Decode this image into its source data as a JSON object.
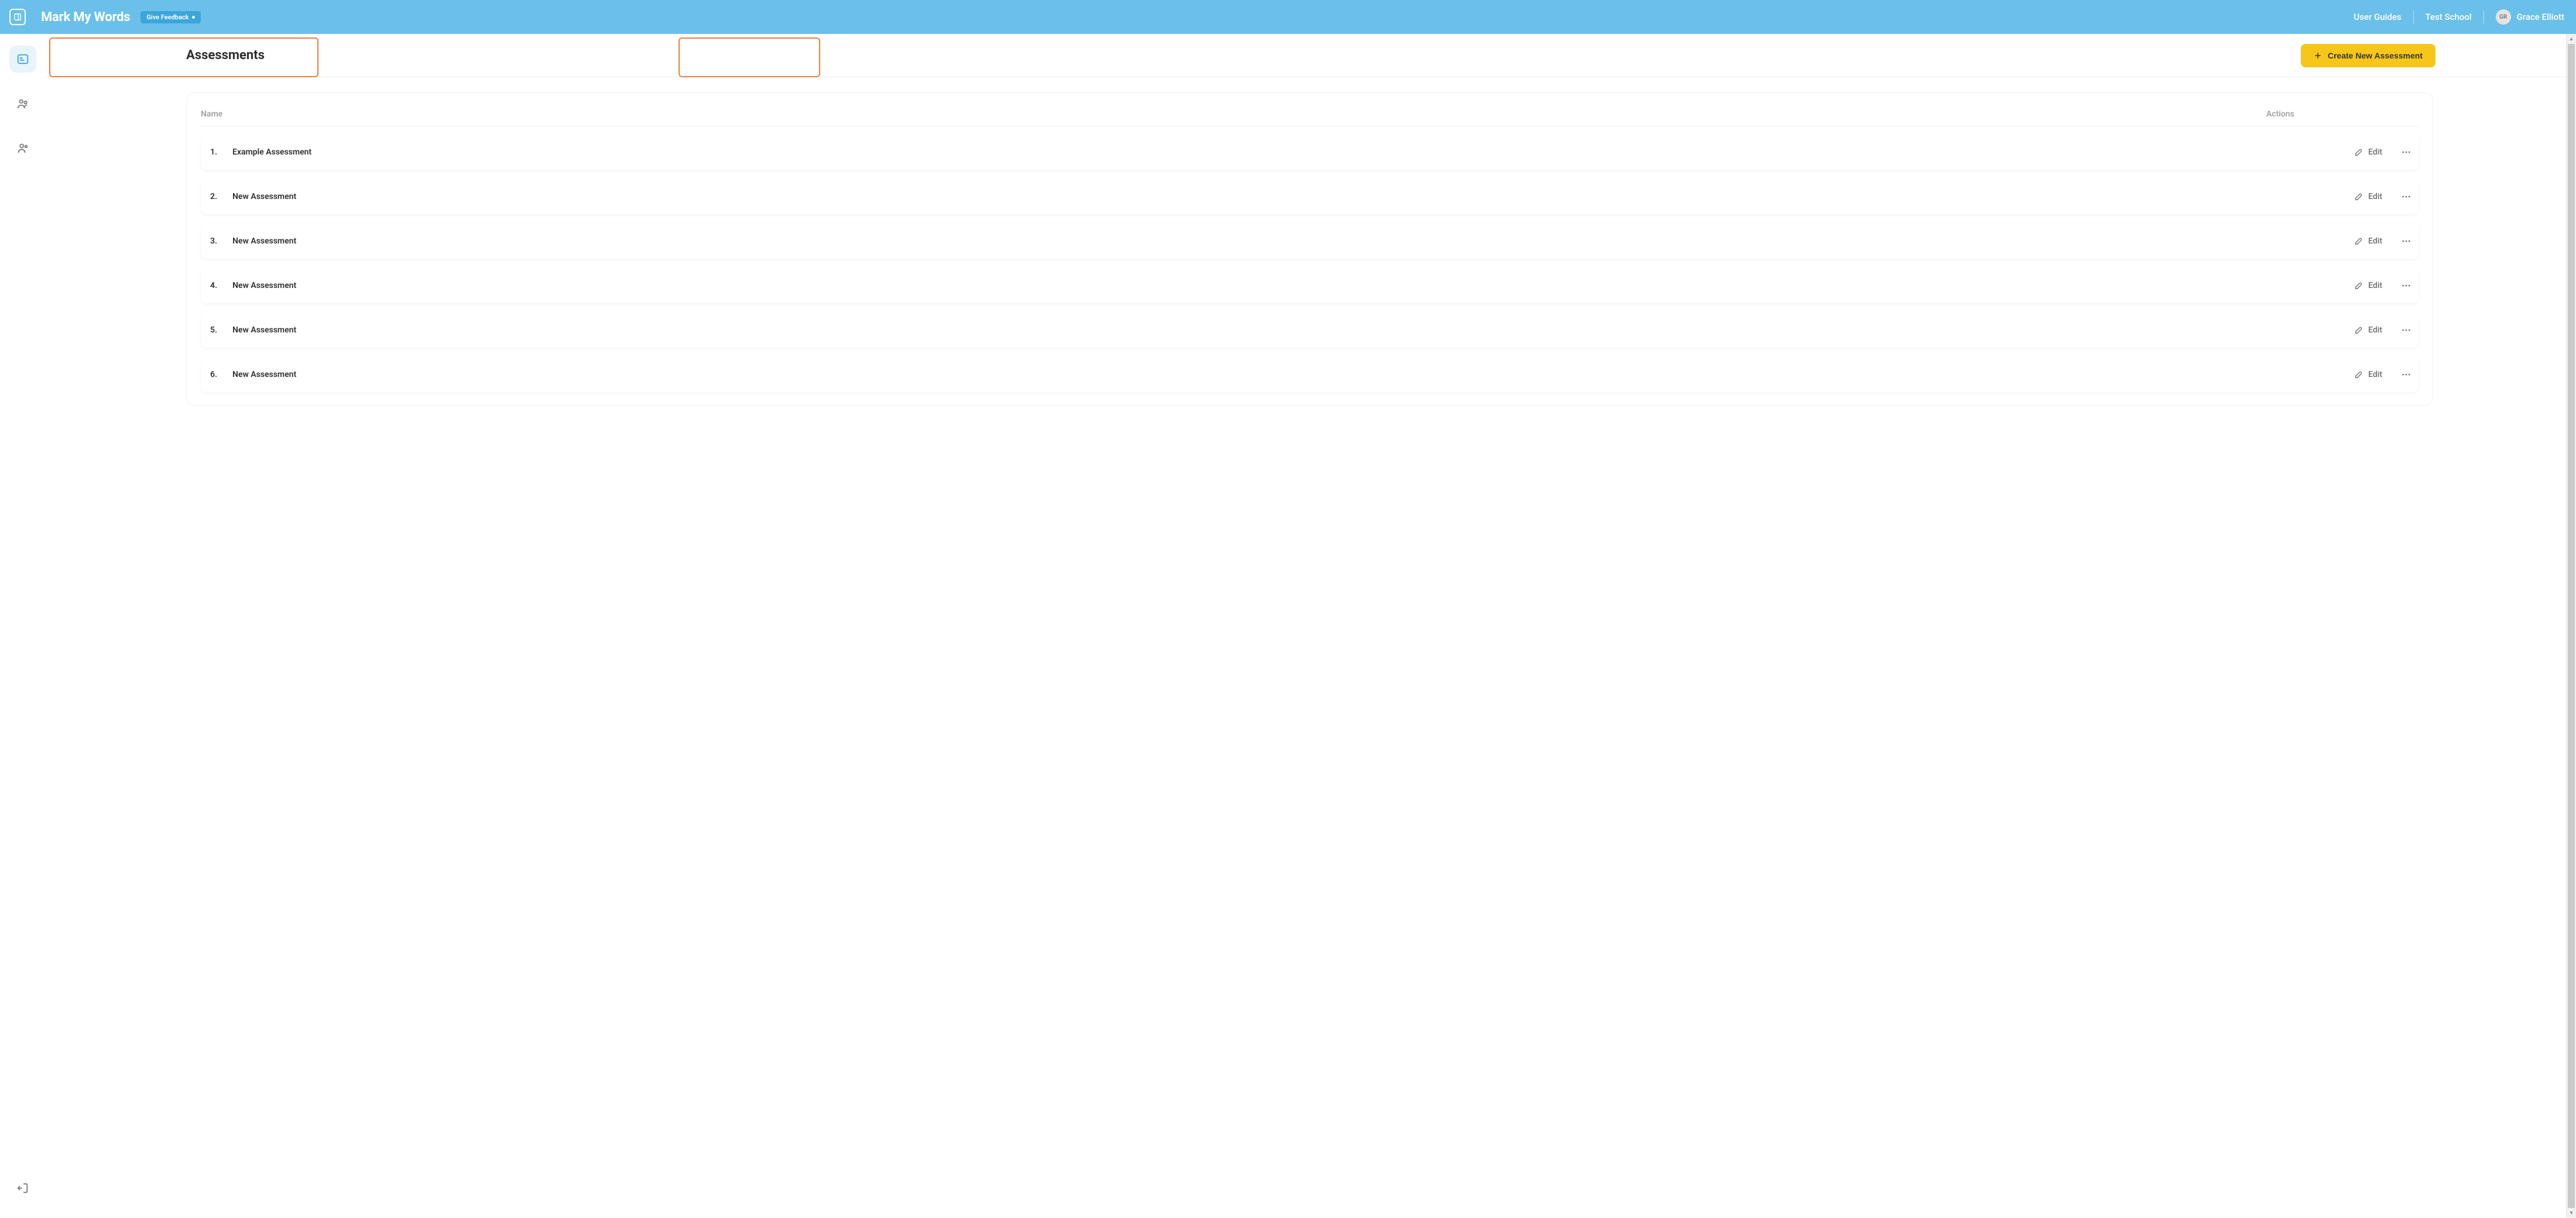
{
  "topbar": {
    "app_title": "Mark My Words",
    "feedback_label": "Give Feedback",
    "nav": {
      "guides": "User Guides",
      "school": "Test School"
    },
    "user": {
      "initials": "GR",
      "name": "Grace Elliott"
    }
  },
  "sidebar": {
    "items": [
      {
        "name": "assessments",
        "active": true
      },
      {
        "name": "groups",
        "active": false
      },
      {
        "name": "people",
        "active": false
      }
    ]
  },
  "page": {
    "title": "Assessments",
    "create_label": "Create New Assessment",
    "columns": {
      "name": "Name",
      "actions": "Actions"
    },
    "edit_label": "Edit",
    "rows": [
      {
        "idx": "1.",
        "name": "Example Assessment"
      },
      {
        "idx": "2.",
        "name": "New Assessment"
      },
      {
        "idx": "3.",
        "name": "New Assessment"
      },
      {
        "idx": "4.",
        "name": "New Assessment"
      },
      {
        "idx": "5.",
        "name": "New Assessment"
      },
      {
        "idx": "6.",
        "name": "New Assessment"
      }
    ]
  }
}
